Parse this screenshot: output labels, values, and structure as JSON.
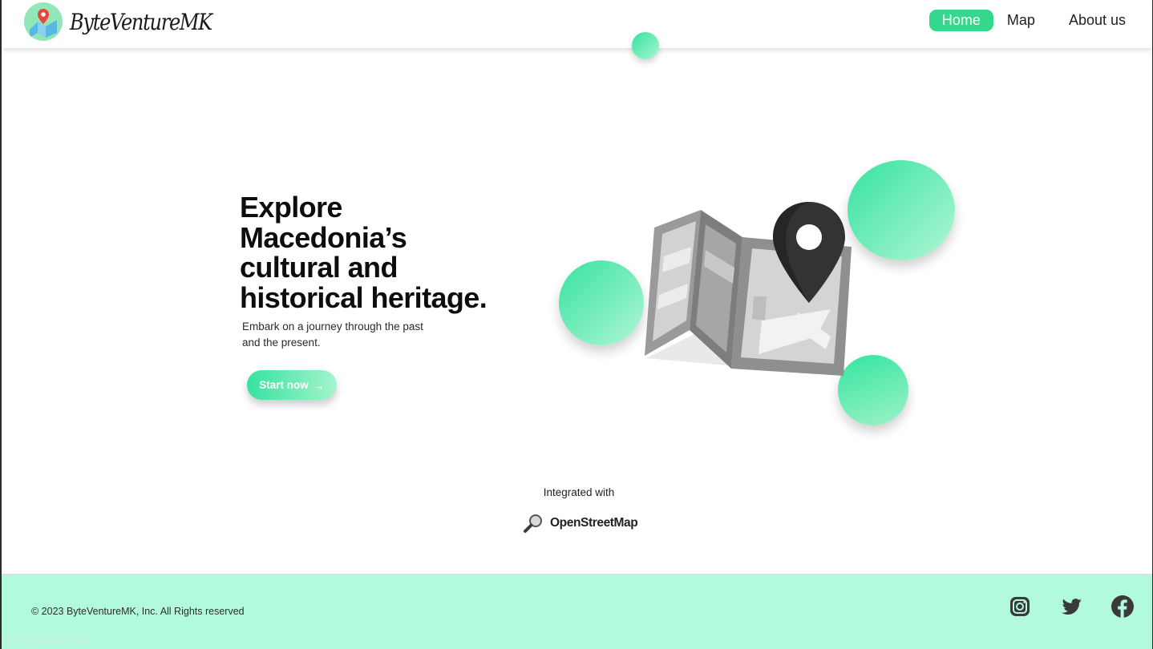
{
  "header": {
    "brand_name": "ByteVentureMK",
    "nav": {
      "home": "Home",
      "map": "Map",
      "about": "About us"
    }
  },
  "hero": {
    "title": "Explore Macedonia’s cultural and historical heritage.",
    "subtitle": "Embark on a journey through the past and the present.",
    "cta_label": "Start now",
    "cta_icon": "arrow-right-icon"
  },
  "integration": {
    "label": "Integrated with",
    "partner": "OpenStreetMap",
    "partner_icon": "magnifier-icon"
  },
  "footer": {
    "copyright": "© 2023 ByteVentureMK, Inc. All Rights reserved",
    "socials": [
      "instagram-icon",
      "twitter-icon",
      "facebook-icon"
    ],
    "status_link": "div#about-us"
  },
  "colors": {
    "accent": "#35d68d",
    "bubble_start": "#35e3a0",
    "bubble_end": "#b2f6d5",
    "footer_bg": "#b2fadd",
    "pin": "#333333"
  }
}
